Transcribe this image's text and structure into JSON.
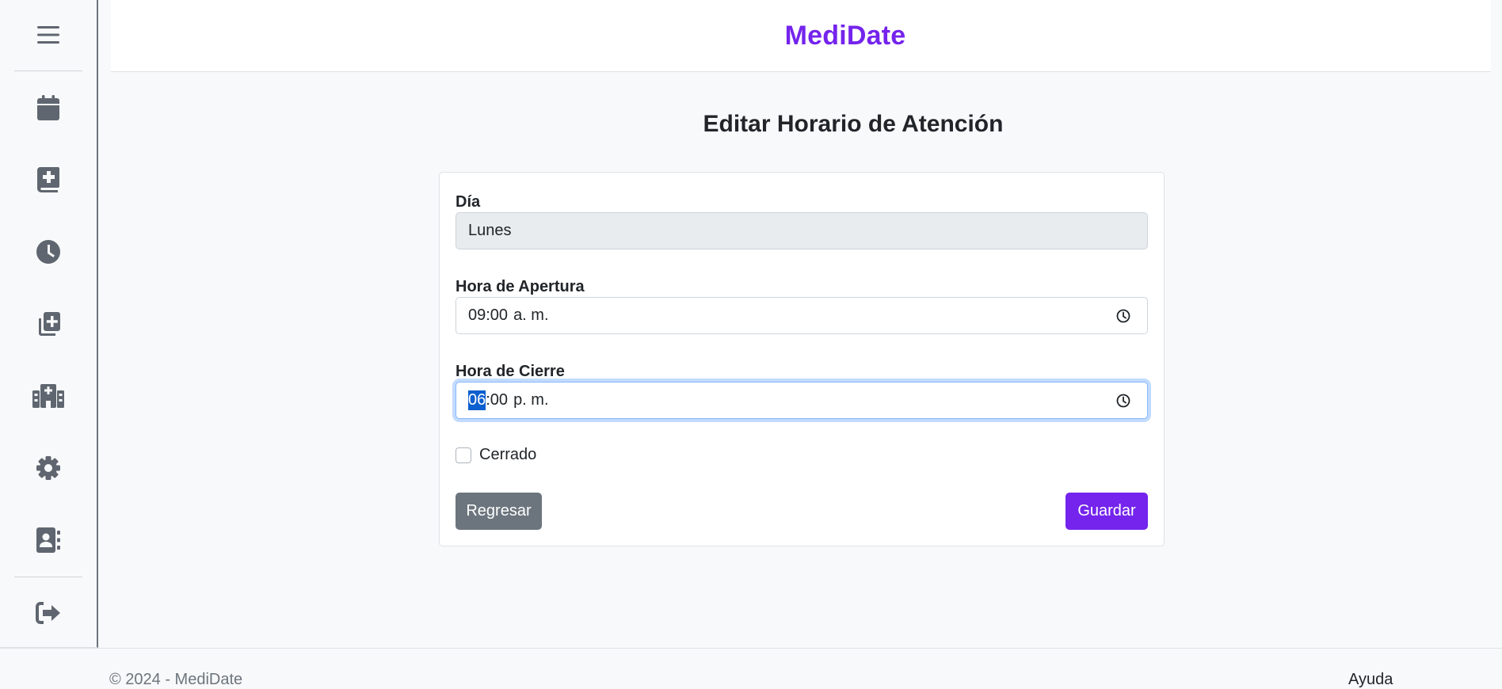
{
  "app": {
    "brand": "MediDate"
  },
  "sidebar": {
    "items": [
      {
        "icon": "menu-icon"
      },
      {
        "icon": "calendar-icon"
      },
      {
        "icon": "medical-book-icon"
      },
      {
        "icon": "clock-icon"
      },
      {
        "icon": "add-copy-icon"
      },
      {
        "icon": "hospital-icon"
      },
      {
        "icon": "gear-icon"
      },
      {
        "icon": "contact-book-icon"
      },
      {
        "icon": "logout-icon"
      }
    ]
  },
  "page": {
    "title": "Editar Horario de Atención"
  },
  "form": {
    "day_label": "Día",
    "day_value": "Lunes",
    "open_label": "Hora de Apertura",
    "open_hour": "09",
    "open_minute": ":00",
    "open_period": "a. m.",
    "close_label": "Hora de Cierre",
    "close_hour": "06",
    "close_minute": ":00",
    "close_period": "p. m.",
    "closed_label": "Cerrado",
    "closed_checked": false,
    "back_label": "Regresar",
    "save_label": "Guardar"
  },
  "footer": {
    "copyright": "© 2024 - MediDate",
    "help": "Ayuda"
  },
  "colors": {
    "brand": "#7424ec",
    "secondary": "#6c757d",
    "focus": "#86b7fe"
  }
}
